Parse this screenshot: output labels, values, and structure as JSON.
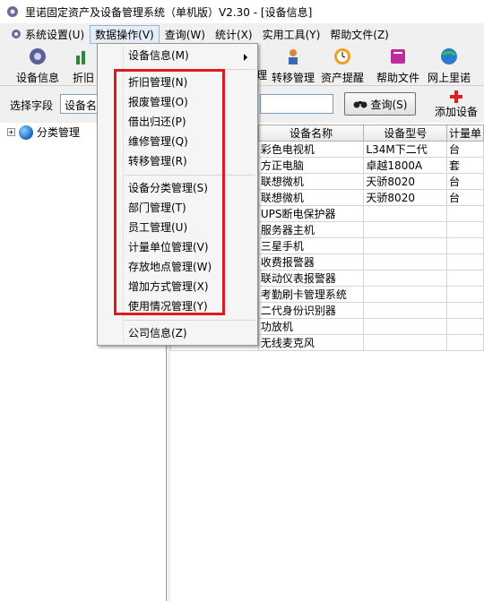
{
  "window": {
    "title": "里诺固定资产及设备管理系统（单机版）V2.30 - [设备信息]"
  },
  "menubar": {
    "items": [
      "系统设置(U)",
      "数据操作(V)",
      "查询(W)",
      "统计(X)",
      "实用工具(Y)",
      "帮助文件(Z)"
    ],
    "active": "数据操作(V)"
  },
  "toolbar": {
    "buttons": [
      "设备信息",
      "折旧",
      "理",
      "转移管理",
      "资产提醒",
      "帮助文件",
      "网上里诺"
    ]
  },
  "search": {
    "label": "选择字段",
    "field_value": "设备名",
    "query_button": "查询(S)",
    "add_button": "添加设备"
  },
  "tree": {
    "root": "分类管理"
  },
  "table": {
    "headers": [
      "设备名称",
      "设备型号",
      "计量单"
    ],
    "rows": [
      [
        "彩色电视机",
        "L34M下二代",
        "台"
      ],
      [
        "方正电脑",
        "卓越1800A",
        "套"
      ],
      [
        "联想微机",
        "天骄8020",
        "台"
      ],
      [
        "联想微机",
        "天骄8020",
        "台"
      ],
      [
        "UPS断电保护器",
        "",
        ""
      ],
      [
        "服务器主机",
        "",
        ""
      ],
      [
        "三星手机",
        "",
        ""
      ],
      [
        "收费报警器",
        "",
        ""
      ],
      [
        "联动仪表报警器",
        "",
        ""
      ],
      [
        "考勤刷卡管理系统",
        "",
        ""
      ],
      [
        "二代身份识别器",
        "",
        ""
      ],
      [
        "功放机",
        "",
        ""
      ],
      [
        "无线麦克风",
        "",
        ""
      ]
    ]
  },
  "dropdown": {
    "device_info": "设备信息(M)",
    "group1": [
      "折旧管理(N)",
      "报废管理(O)",
      "借出归还(P)",
      "维修管理(Q)",
      "转移管理(R)"
    ],
    "group2": [
      "设备分类管理(S)",
      "部门管理(T)",
      "员工管理(U)",
      "计量单位管理(V)",
      "存放地点管理(W)",
      "增加方式管理(X)",
      "使用情况管理(Y)"
    ],
    "company_info": "公司信息(Z)"
  },
  "colors": {
    "highlight_box": "#e0191c",
    "menu_bg": "#f5f5f5"
  }
}
